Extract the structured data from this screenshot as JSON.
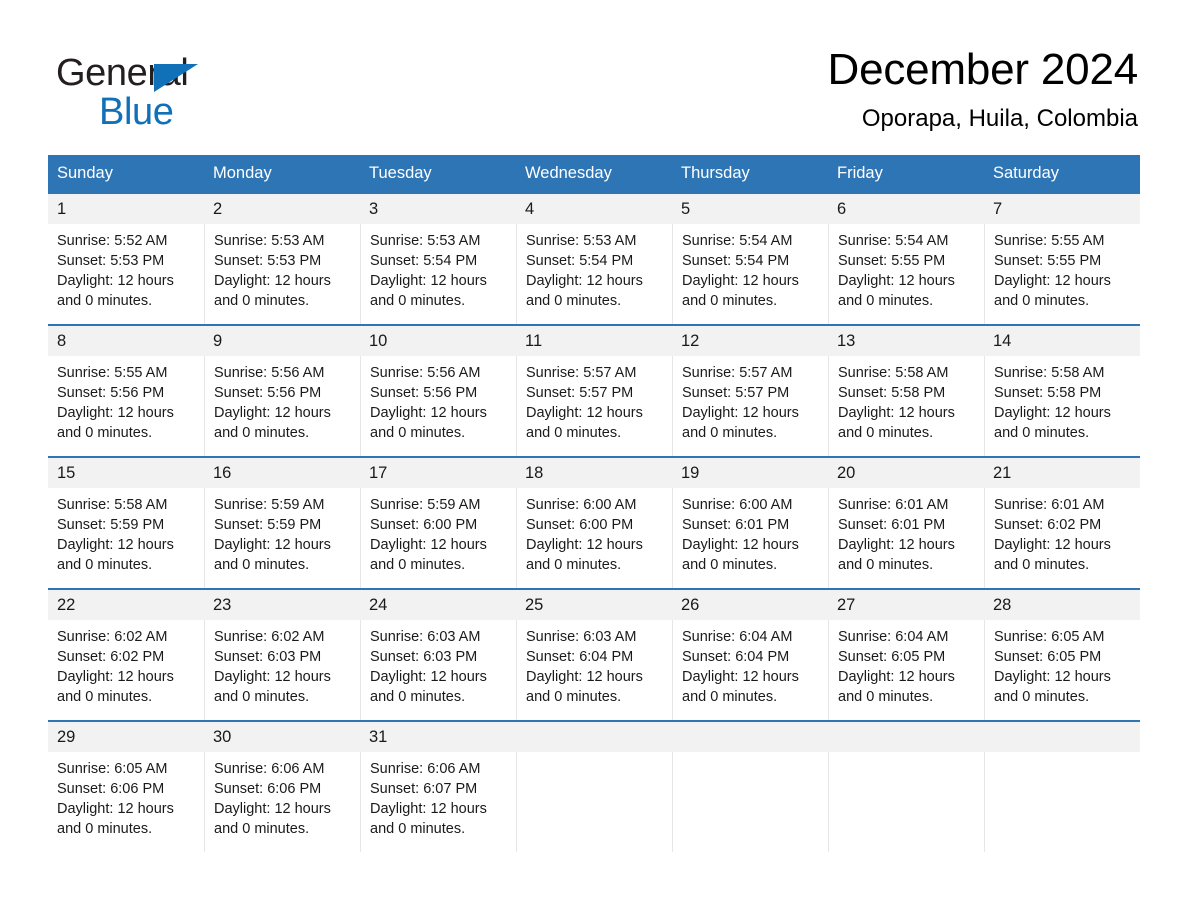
{
  "brand": {
    "name_part1": "General",
    "name_part2": "Blue",
    "triangle_icon": "brand-triangle-icon",
    "accent_color": "#1070b8"
  },
  "header": {
    "title": "December 2024",
    "subtitle": "Oporapa, Huila, Colombia"
  },
  "colors": {
    "header_bar": "#2e75b6",
    "daynum_band": "#f2f2f2",
    "text": "#1a1a1a"
  },
  "weekday_headers": [
    "Sunday",
    "Monday",
    "Tuesday",
    "Wednesday",
    "Thursday",
    "Friday",
    "Saturday"
  ],
  "weeks": [
    {
      "days": [
        {
          "num": "1",
          "sunrise": "Sunrise: 5:52 AM",
          "sunset": "Sunset: 5:53 PM",
          "daylight1": "Daylight: 12 hours",
          "daylight2": "and 0 minutes."
        },
        {
          "num": "2",
          "sunrise": "Sunrise: 5:53 AM",
          "sunset": "Sunset: 5:53 PM",
          "daylight1": "Daylight: 12 hours",
          "daylight2": "and 0 minutes."
        },
        {
          "num": "3",
          "sunrise": "Sunrise: 5:53 AM",
          "sunset": "Sunset: 5:54 PM",
          "daylight1": "Daylight: 12 hours",
          "daylight2": "and 0 minutes."
        },
        {
          "num": "4",
          "sunrise": "Sunrise: 5:53 AM",
          "sunset": "Sunset: 5:54 PM",
          "daylight1": "Daylight: 12 hours",
          "daylight2": "and 0 minutes."
        },
        {
          "num": "5",
          "sunrise": "Sunrise: 5:54 AM",
          "sunset": "Sunset: 5:54 PM",
          "daylight1": "Daylight: 12 hours",
          "daylight2": "and 0 minutes."
        },
        {
          "num": "6",
          "sunrise": "Sunrise: 5:54 AM",
          "sunset": "Sunset: 5:55 PM",
          "daylight1": "Daylight: 12 hours",
          "daylight2": "and 0 minutes."
        },
        {
          "num": "7",
          "sunrise": "Sunrise: 5:55 AM",
          "sunset": "Sunset: 5:55 PM",
          "daylight1": "Daylight: 12 hours",
          "daylight2": "and 0 minutes."
        }
      ]
    },
    {
      "days": [
        {
          "num": "8",
          "sunrise": "Sunrise: 5:55 AM",
          "sunset": "Sunset: 5:56 PM",
          "daylight1": "Daylight: 12 hours",
          "daylight2": "and 0 minutes."
        },
        {
          "num": "9",
          "sunrise": "Sunrise: 5:56 AM",
          "sunset": "Sunset: 5:56 PM",
          "daylight1": "Daylight: 12 hours",
          "daylight2": "and 0 minutes."
        },
        {
          "num": "10",
          "sunrise": "Sunrise: 5:56 AM",
          "sunset": "Sunset: 5:56 PM",
          "daylight1": "Daylight: 12 hours",
          "daylight2": "and 0 minutes."
        },
        {
          "num": "11",
          "sunrise": "Sunrise: 5:57 AM",
          "sunset": "Sunset: 5:57 PM",
          "daylight1": "Daylight: 12 hours",
          "daylight2": "and 0 minutes."
        },
        {
          "num": "12",
          "sunrise": "Sunrise: 5:57 AM",
          "sunset": "Sunset: 5:57 PM",
          "daylight1": "Daylight: 12 hours",
          "daylight2": "and 0 minutes."
        },
        {
          "num": "13",
          "sunrise": "Sunrise: 5:58 AM",
          "sunset": "Sunset: 5:58 PM",
          "daylight1": "Daylight: 12 hours",
          "daylight2": "and 0 minutes."
        },
        {
          "num": "14",
          "sunrise": "Sunrise: 5:58 AM",
          "sunset": "Sunset: 5:58 PM",
          "daylight1": "Daylight: 12 hours",
          "daylight2": "and 0 minutes."
        }
      ]
    },
    {
      "days": [
        {
          "num": "15",
          "sunrise": "Sunrise: 5:58 AM",
          "sunset": "Sunset: 5:59 PM",
          "daylight1": "Daylight: 12 hours",
          "daylight2": "and 0 minutes."
        },
        {
          "num": "16",
          "sunrise": "Sunrise: 5:59 AM",
          "sunset": "Sunset: 5:59 PM",
          "daylight1": "Daylight: 12 hours",
          "daylight2": "and 0 minutes."
        },
        {
          "num": "17",
          "sunrise": "Sunrise: 5:59 AM",
          "sunset": "Sunset: 6:00 PM",
          "daylight1": "Daylight: 12 hours",
          "daylight2": "and 0 minutes."
        },
        {
          "num": "18",
          "sunrise": "Sunrise: 6:00 AM",
          "sunset": "Sunset: 6:00 PM",
          "daylight1": "Daylight: 12 hours",
          "daylight2": "and 0 minutes."
        },
        {
          "num": "19",
          "sunrise": "Sunrise: 6:00 AM",
          "sunset": "Sunset: 6:01 PM",
          "daylight1": "Daylight: 12 hours",
          "daylight2": "and 0 minutes."
        },
        {
          "num": "20",
          "sunrise": "Sunrise: 6:01 AM",
          "sunset": "Sunset: 6:01 PM",
          "daylight1": "Daylight: 12 hours",
          "daylight2": "and 0 minutes."
        },
        {
          "num": "21",
          "sunrise": "Sunrise: 6:01 AM",
          "sunset": "Sunset: 6:02 PM",
          "daylight1": "Daylight: 12 hours",
          "daylight2": "and 0 minutes."
        }
      ]
    },
    {
      "days": [
        {
          "num": "22",
          "sunrise": "Sunrise: 6:02 AM",
          "sunset": "Sunset: 6:02 PM",
          "daylight1": "Daylight: 12 hours",
          "daylight2": "and 0 minutes."
        },
        {
          "num": "23",
          "sunrise": "Sunrise: 6:02 AM",
          "sunset": "Sunset: 6:03 PM",
          "daylight1": "Daylight: 12 hours",
          "daylight2": "and 0 minutes."
        },
        {
          "num": "24",
          "sunrise": "Sunrise: 6:03 AM",
          "sunset": "Sunset: 6:03 PM",
          "daylight1": "Daylight: 12 hours",
          "daylight2": "and 0 minutes."
        },
        {
          "num": "25",
          "sunrise": "Sunrise: 6:03 AM",
          "sunset": "Sunset: 6:04 PM",
          "daylight1": "Daylight: 12 hours",
          "daylight2": "and 0 minutes."
        },
        {
          "num": "26",
          "sunrise": "Sunrise: 6:04 AM",
          "sunset": "Sunset: 6:04 PM",
          "daylight1": "Daylight: 12 hours",
          "daylight2": "and 0 minutes."
        },
        {
          "num": "27",
          "sunrise": "Sunrise: 6:04 AM",
          "sunset": "Sunset: 6:05 PM",
          "daylight1": "Daylight: 12 hours",
          "daylight2": "and 0 minutes."
        },
        {
          "num": "28",
          "sunrise": "Sunrise: 6:05 AM",
          "sunset": "Sunset: 6:05 PM",
          "daylight1": "Daylight: 12 hours",
          "daylight2": "and 0 minutes."
        }
      ]
    },
    {
      "days": [
        {
          "num": "29",
          "sunrise": "Sunrise: 6:05 AM",
          "sunset": "Sunset: 6:06 PM",
          "daylight1": "Daylight: 12 hours",
          "daylight2": "and 0 minutes."
        },
        {
          "num": "30",
          "sunrise": "Sunrise: 6:06 AM",
          "sunset": "Sunset: 6:06 PM",
          "daylight1": "Daylight: 12 hours",
          "daylight2": "and 0 minutes."
        },
        {
          "num": "31",
          "sunrise": "Sunrise: 6:06 AM",
          "sunset": "Sunset: 6:07 PM",
          "daylight1": "Daylight: 12 hours",
          "daylight2": "and 0 minutes."
        },
        {
          "num": "",
          "sunrise": "",
          "sunset": "",
          "daylight1": "",
          "daylight2": ""
        },
        {
          "num": "",
          "sunrise": "",
          "sunset": "",
          "daylight1": "",
          "daylight2": ""
        },
        {
          "num": "",
          "sunrise": "",
          "sunset": "",
          "daylight1": "",
          "daylight2": ""
        },
        {
          "num": "",
          "sunrise": "",
          "sunset": "",
          "daylight1": "",
          "daylight2": ""
        }
      ]
    }
  ]
}
